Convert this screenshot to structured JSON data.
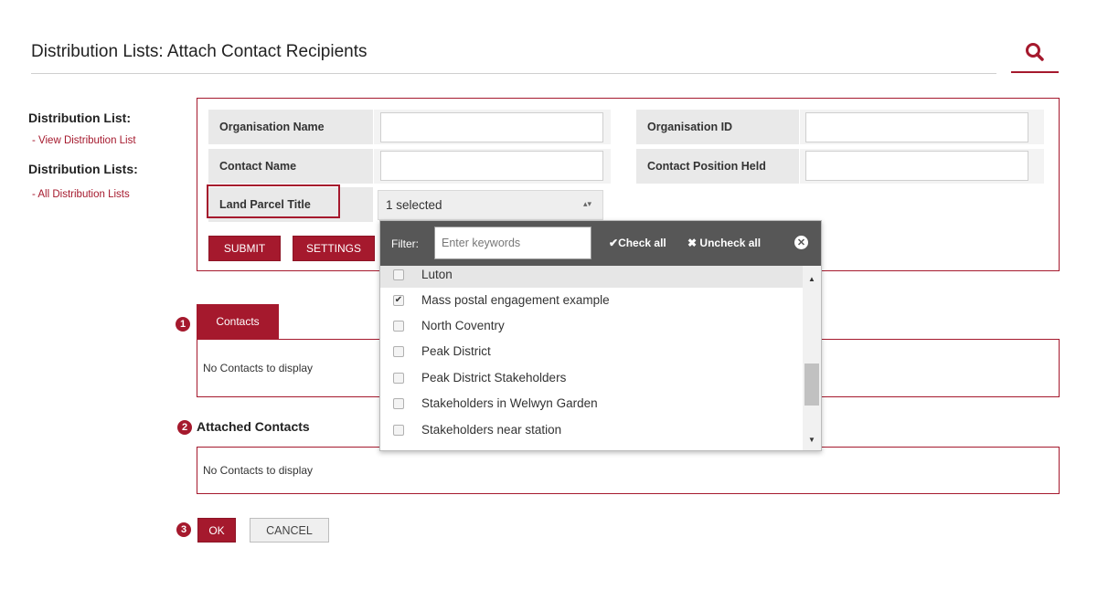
{
  "page": {
    "title": "Distribution Lists: Attach Contact Recipients"
  },
  "nav": {
    "heading1": "Distribution List:",
    "link1": "- View Distribution List",
    "heading2": "Distribution Lists:",
    "link2": "- All Distribution Lists"
  },
  "filters": {
    "org_name_label": "Organisation Name",
    "org_id_label": "Organisation ID",
    "contact_name_label": "Contact Name",
    "contact_position_label": "Contact Position Held",
    "land_parcel_label": "Land Parcel Title",
    "land_parcel_value": "1 selected",
    "submit_label": "SUBMIT",
    "settings_label": "SETTINGS"
  },
  "dropdown": {
    "filter_label": "Filter:",
    "filter_placeholder": "Enter keywords",
    "check_all": "Check all",
    "uncheck_all": "Uncheck all",
    "items": [
      {
        "label": "Luton",
        "checked": false
      },
      {
        "label": "Mass postal engagement example",
        "checked": true
      },
      {
        "label": "North Coventry",
        "checked": false
      },
      {
        "label": "Peak District",
        "checked": false
      },
      {
        "label": "Peak District Stakeholders",
        "checked": false
      },
      {
        "label": "Stakeholders in Welwyn Garden",
        "checked": false
      },
      {
        "label": "Stakeholders near station",
        "checked": false
      }
    ]
  },
  "steps": {
    "one": "1",
    "two": "2",
    "three": "3"
  },
  "contacts": {
    "tab_label": "Contacts",
    "empty_text": "No Contacts to display"
  },
  "attached": {
    "title": "Attached Contacts",
    "empty_text": "No Contacts to display"
  },
  "actions": {
    "ok_label": "OK",
    "cancel_label": "CANCEL"
  },
  "colors": {
    "accent": "#a5192d",
    "dropdown_header": "#575757"
  }
}
